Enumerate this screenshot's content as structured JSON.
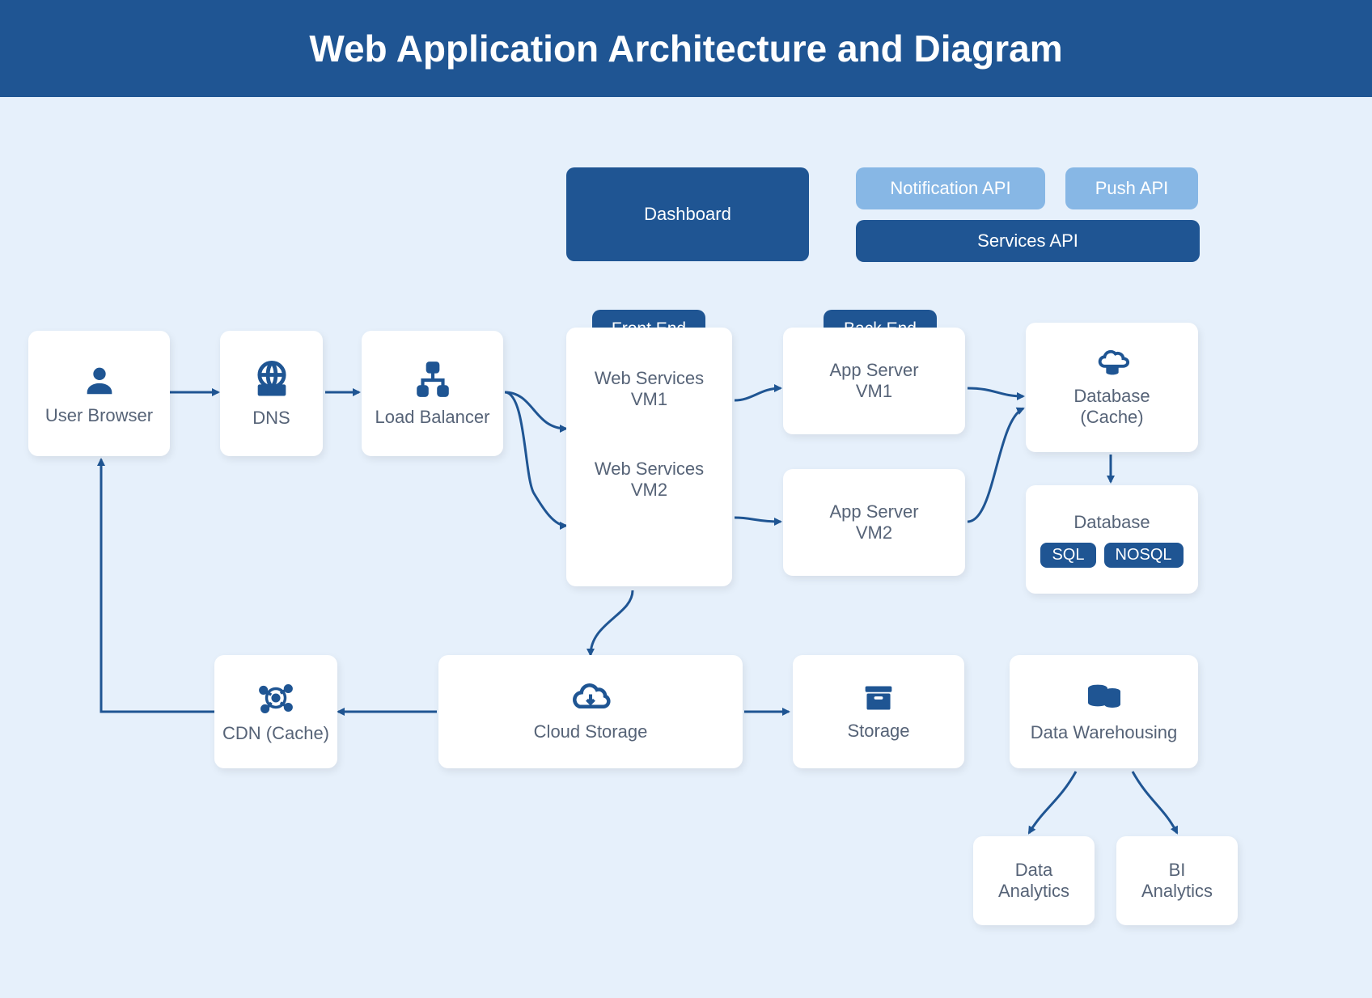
{
  "header": {
    "title": "Web Application Architecture and Diagram"
  },
  "top": {
    "dashboard": "Dashboard",
    "notification_api": "Notification API",
    "push_api": "Push API",
    "services_api": "Services API"
  },
  "tags": {
    "front_end": "Front End",
    "back_end": "Back End"
  },
  "nodes": {
    "user_browser": "User Browser",
    "dns": "DNS",
    "load_balancer": "Load Balancer",
    "web_services_prefix": "Web Services",
    "web_services_vm1": "VM1",
    "web_services_vm2": "VM2",
    "app_server_prefix": "App Server",
    "app_server_vm1": "VM1",
    "app_server_vm2": "VM2",
    "database_cache_1": "Database",
    "database_cache_2": "(Cache)",
    "database": "Database",
    "sql": "SQL",
    "nosql": "NOSQL",
    "cdn": "CDN (Cache)",
    "cloud_storage": "Cloud Storage",
    "storage": "Storage",
    "data_warehousing": "Data Warehousing",
    "data_analytics_1": "Data",
    "data_analytics_2": "Analytics",
    "bi_1": "BI",
    "bi_2": "Analytics"
  }
}
